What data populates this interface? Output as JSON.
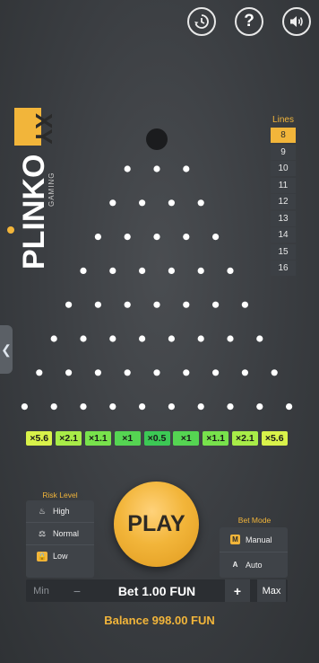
{
  "top_controls": {
    "history_icon": "history-icon",
    "help_label": "?",
    "sound_icon": "sound-icon"
  },
  "logo": {
    "text": "PLINKO",
    "accent_text": "XY",
    "sub_text": "GAMING"
  },
  "side_tab": {
    "label": "❮"
  },
  "lines": {
    "title": "Lines",
    "options": [
      "8",
      "9",
      "10",
      "11",
      "12",
      "13",
      "14",
      "15",
      "16"
    ],
    "selected": "8"
  },
  "board": {
    "rows": 8,
    "multipliers": [
      {
        "label": "×5.6",
        "color": "#d9f24a"
      },
      {
        "label": "×2.1",
        "color": "#a8ec48"
      },
      {
        "label": "×1.1",
        "color": "#78e24c"
      },
      {
        "label": "×1",
        "color": "#55d452"
      },
      {
        "label": "×0.5",
        "color": "#3cc955"
      },
      {
        "label": "×1",
        "color": "#55d452"
      },
      {
        "label": "×1.1",
        "color": "#78e24c"
      },
      {
        "label": "×2.1",
        "color": "#a8ec48"
      },
      {
        "label": "×5.6",
        "color": "#d9f24a"
      }
    ]
  },
  "risk": {
    "title": "Risk Level",
    "options": [
      {
        "label": "High",
        "icon": "flame-icon"
      },
      {
        "label": "Normal",
        "icon": "balance-icon"
      },
      {
        "label": "Low",
        "icon": "lock-icon"
      }
    ],
    "selected": "Low"
  },
  "play": {
    "label": "PLAY"
  },
  "bet_mode": {
    "title": "Bet Mode",
    "options": [
      {
        "label": "Manual",
        "badge": "M"
      },
      {
        "label": "Auto",
        "badge": "A"
      }
    ],
    "selected": "Manual"
  },
  "bet_bar": {
    "min_label": "Min",
    "minus_label": "−",
    "bet_text": "Bet 1.00 FUN",
    "plus_label": "+",
    "max_label": "Max"
  },
  "balance": {
    "text": "Balance 998.00 FUN"
  },
  "colors": {
    "accent": "#f2b53a",
    "background": "#3a3d41",
    "peg": "#ffffff"
  }
}
